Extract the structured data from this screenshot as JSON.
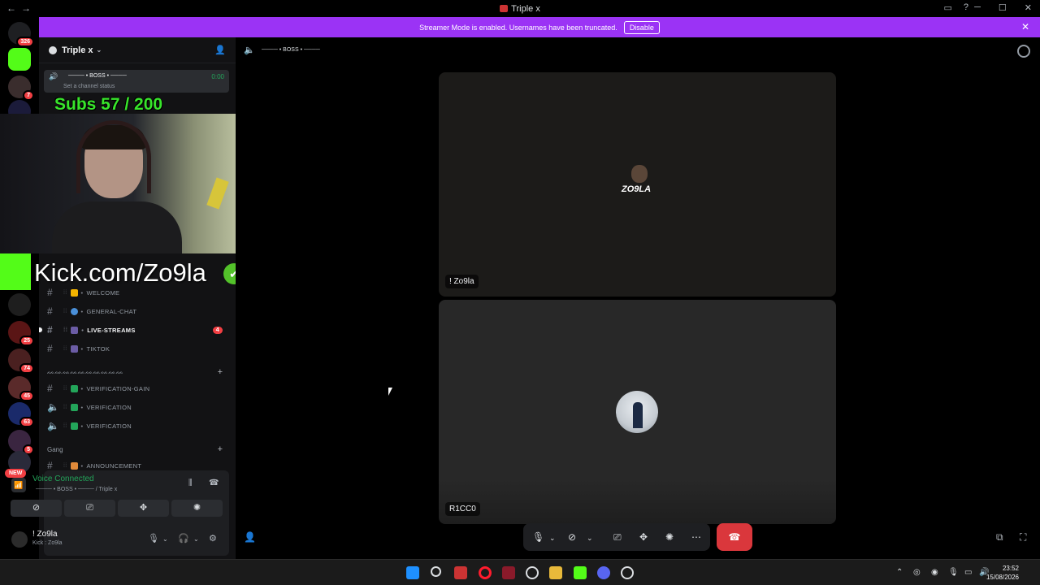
{
  "window": {
    "title": "Triple x",
    "back": "←",
    "forward": "→"
  },
  "banner": {
    "text": "Streamer Mode is enabled. Usernames have been truncated.",
    "button": "Disable",
    "close": "✕"
  },
  "servers": {
    "home_badge": "326",
    "items": [
      {
        "badge": ""
      },
      {
        "badge": "7"
      },
      {
        "badge": ""
      },
      {
        "badge": "25"
      },
      {
        "badge": "74"
      },
      {
        "badge": "45"
      },
      {
        "badge": "63"
      },
      {
        "badge": "5"
      }
    ],
    "new_label": "NEW"
  },
  "guild": {
    "name": "Triple x",
    "chevron": "⌄"
  },
  "voice_channel": {
    "name": "──── • BOSS • ────",
    "status": "Set a channel status",
    "time": "0:00"
  },
  "overlay": {
    "subs": "Subs 57 / 200",
    "kick": "Kick.com/Zo9la",
    "check": "✔"
  },
  "channels": [
    {
      "name": "WELCOME",
      "emoji_color": "#f4b400",
      "active": false,
      "count": ""
    },
    {
      "name": "GENERAL-CHAT",
      "emoji_color": "#4a90d9",
      "active": false,
      "count": ""
    },
    {
      "name": "LIVE-STREAMS",
      "emoji_color": "#6b5ca5",
      "active": true,
      "count": "4"
    },
    {
      "name": "TIKTOK",
      "emoji_color": "#6b5ca5",
      "active": false,
      "count": ""
    }
  ],
  "category_verification": {
    "name": "ᨐᨐᨐᨐᨐᨐᨐᨐᨐᨐ",
    "plus": "+"
  },
  "verification_channels": [
    {
      "name": "VERIFICATION-GAIN",
      "type": "text"
    },
    {
      "name": "VERIFICATION",
      "type": "voice"
    },
    {
      "name": "VERIFICATION",
      "type": "voice"
    }
  ],
  "category_gang": {
    "name": "Gang",
    "plus": "+"
  },
  "announcement": {
    "name": "ANNOUNCEMENT"
  },
  "voice_panel": {
    "title": "Voice Connected",
    "subtitle": "──── • BOSS • ──── / Triple x"
  },
  "user": {
    "name": "! Zo9la",
    "status": "Kick : Zo9la"
  },
  "stage": {
    "channel_name": "──── • BOSS • ────",
    "tiles": [
      {
        "label": "! Zo9la",
        "logo_text": "ZO9LA"
      },
      {
        "label": "R1CC0"
      }
    ]
  },
  "taskbar": {
    "time": "23:52",
    "date": "15/08/2026"
  },
  "colors": {
    "accent_purple": "#9b33f5",
    "voice_green": "#23a55a",
    "danger_red": "#da373c",
    "kick_green": "#53fc18"
  }
}
